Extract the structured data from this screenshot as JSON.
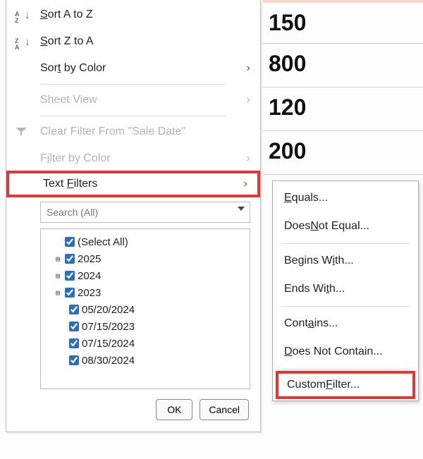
{
  "cells": [
    "150",
    "800",
    "120",
    "200"
  ],
  "menu": {
    "sort_az_pre": "S",
    "sort_az_post": "ort A to Z",
    "sort_za_pre": "S",
    "sort_za_post": "ort Z to A",
    "sort_color_pre1": "Sor",
    "sort_color_u": "t",
    "sort_color_post": " by Color",
    "sheet_view": "Sheet View",
    "clear_filter": "Clear Filter From \"Sale Date\"",
    "filter_color_pre": "F",
    "filter_color_u": "i",
    "filter_color_post": "lter by Color",
    "text_filters_pre": "Text ",
    "text_filters_u": "F",
    "text_filters_post": "ilters",
    "search_placeholder": "Search (All)"
  },
  "tree": {
    "select_all": "(Select All)",
    "y1": "2025",
    "y2": "2024",
    "y3": "2023",
    "d1": "05/20/2024",
    "d2": "07/15/2023",
    "d3": "07/15/2024",
    "d4": "08/30/2024"
  },
  "buttons": {
    "ok": "OK",
    "cancel": "Cancel"
  },
  "submenu": {
    "equals_u": "E",
    "equals_post": "quals...",
    "dne_pre": "Does ",
    "dne_u": "N",
    "dne_post": "ot Equal...",
    "begins_pre": "Begins W",
    "begins_u": "i",
    "begins_post": "th...",
    "ends_pre": "Ends Wi",
    "ends_u": "t",
    "ends_post": "h...",
    "contains_pre": "Cont",
    "contains_u": "a",
    "contains_post": "ins...",
    "dnc_u": "D",
    "dnc_post": "oes Not Contain...",
    "custom_pre": "Custom ",
    "custom_u": "F",
    "custom_post": "ilter..."
  }
}
